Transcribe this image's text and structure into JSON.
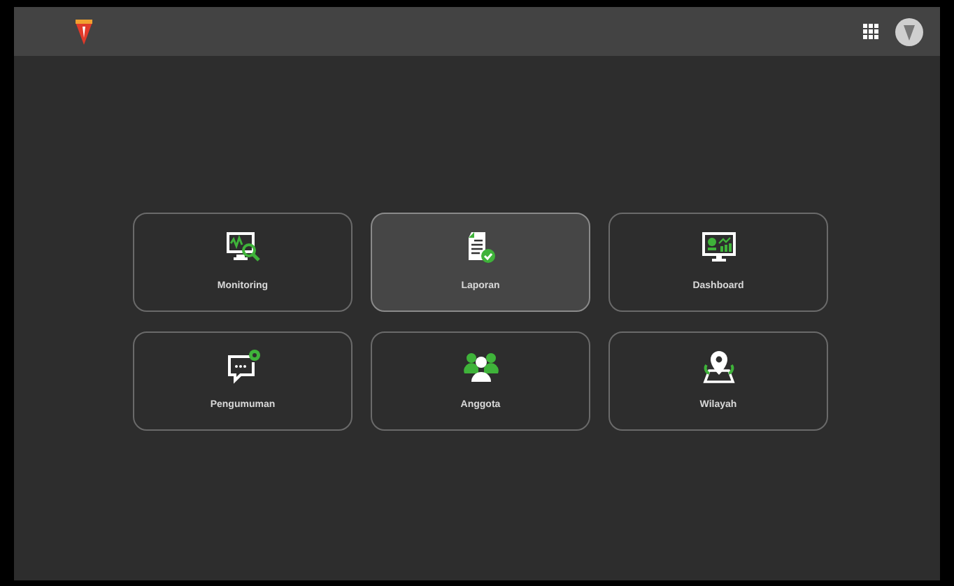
{
  "menu": [
    {
      "label": "Monitoring",
      "kind": "monitoring",
      "selected": false
    },
    {
      "label": "Laporan",
      "kind": "report",
      "selected": true
    },
    {
      "label": "Dashboard",
      "kind": "dashboard",
      "selected": false
    },
    {
      "label": "Pengumuman",
      "kind": "announcement",
      "selected": false
    },
    {
      "label": "Anggota",
      "kind": "members",
      "selected": false
    },
    {
      "label": "Wilayah",
      "kind": "region",
      "selected": false
    }
  ]
}
